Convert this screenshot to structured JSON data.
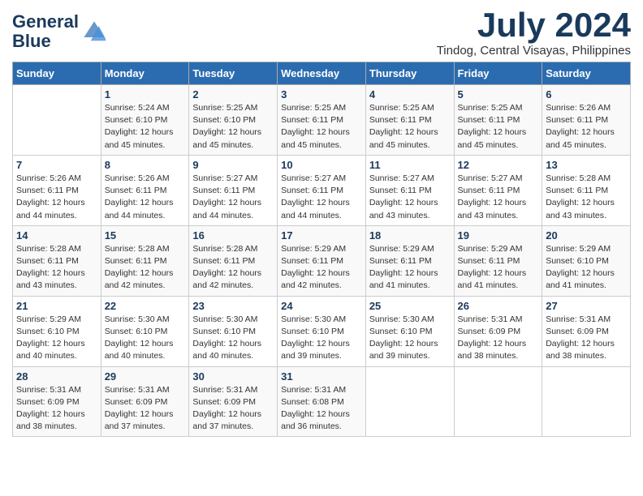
{
  "logo": {
    "line1": "General",
    "line2": "Blue"
  },
  "title": {
    "month_year": "July 2024",
    "location": "Tindog, Central Visayas, Philippines"
  },
  "days_of_week": [
    "Sunday",
    "Monday",
    "Tuesday",
    "Wednesday",
    "Thursday",
    "Friday",
    "Saturday"
  ],
  "weeks": [
    [
      {
        "day": "",
        "info": ""
      },
      {
        "day": "1",
        "info": "Sunrise: 5:24 AM\nSunset: 6:10 PM\nDaylight: 12 hours\nand 45 minutes."
      },
      {
        "day": "2",
        "info": "Sunrise: 5:25 AM\nSunset: 6:10 PM\nDaylight: 12 hours\nand 45 minutes."
      },
      {
        "day": "3",
        "info": "Sunrise: 5:25 AM\nSunset: 6:11 PM\nDaylight: 12 hours\nand 45 minutes."
      },
      {
        "day": "4",
        "info": "Sunrise: 5:25 AM\nSunset: 6:11 PM\nDaylight: 12 hours\nand 45 minutes."
      },
      {
        "day": "5",
        "info": "Sunrise: 5:25 AM\nSunset: 6:11 PM\nDaylight: 12 hours\nand 45 minutes."
      },
      {
        "day": "6",
        "info": "Sunrise: 5:26 AM\nSunset: 6:11 PM\nDaylight: 12 hours\nand 45 minutes."
      }
    ],
    [
      {
        "day": "7",
        "info": "Sunrise: 5:26 AM\nSunset: 6:11 PM\nDaylight: 12 hours\nand 44 minutes."
      },
      {
        "day": "8",
        "info": "Sunrise: 5:26 AM\nSunset: 6:11 PM\nDaylight: 12 hours\nand 44 minutes."
      },
      {
        "day": "9",
        "info": "Sunrise: 5:27 AM\nSunset: 6:11 PM\nDaylight: 12 hours\nand 44 minutes."
      },
      {
        "day": "10",
        "info": "Sunrise: 5:27 AM\nSunset: 6:11 PM\nDaylight: 12 hours\nand 44 minutes."
      },
      {
        "day": "11",
        "info": "Sunrise: 5:27 AM\nSunset: 6:11 PM\nDaylight: 12 hours\nand 43 minutes."
      },
      {
        "day": "12",
        "info": "Sunrise: 5:27 AM\nSunset: 6:11 PM\nDaylight: 12 hours\nand 43 minutes."
      },
      {
        "day": "13",
        "info": "Sunrise: 5:28 AM\nSunset: 6:11 PM\nDaylight: 12 hours\nand 43 minutes."
      }
    ],
    [
      {
        "day": "14",
        "info": "Sunrise: 5:28 AM\nSunset: 6:11 PM\nDaylight: 12 hours\nand 43 minutes."
      },
      {
        "day": "15",
        "info": "Sunrise: 5:28 AM\nSunset: 6:11 PM\nDaylight: 12 hours\nand 42 minutes."
      },
      {
        "day": "16",
        "info": "Sunrise: 5:28 AM\nSunset: 6:11 PM\nDaylight: 12 hours\nand 42 minutes."
      },
      {
        "day": "17",
        "info": "Sunrise: 5:29 AM\nSunset: 6:11 PM\nDaylight: 12 hours\nand 42 minutes."
      },
      {
        "day": "18",
        "info": "Sunrise: 5:29 AM\nSunset: 6:11 PM\nDaylight: 12 hours\nand 41 minutes."
      },
      {
        "day": "19",
        "info": "Sunrise: 5:29 AM\nSunset: 6:11 PM\nDaylight: 12 hours\nand 41 minutes."
      },
      {
        "day": "20",
        "info": "Sunrise: 5:29 AM\nSunset: 6:10 PM\nDaylight: 12 hours\nand 41 minutes."
      }
    ],
    [
      {
        "day": "21",
        "info": "Sunrise: 5:29 AM\nSunset: 6:10 PM\nDaylight: 12 hours\nand 40 minutes."
      },
      {
        "day": "22",
        "info": "Sunrise: 5:30 AM\nSunset: 6:10 PM\nDaylight: 12 hours\nand 40 minutes."
      },
      {
        "day": "23",
        "info": "Sunrise: 5:30 AM\nSunset: 6:10 PM\nDaylight: 12 hours\nand 40 minutes."
      },
      {
        "day": "24",
        "info": "Sunrise: 5:30 AM\nSunset: 6:10 PM\nDaylight: 12 hours\nand 39 minutes."
      },
      {
        "day": "25",
        "info": "Sunrise: 5:30 AM\nSunset: 6:10 PM\nDaylight: 12 hours\nand 39 minutes."
      },
      {
        "day": "26",
        "info": "Sunrise: 5:31 AM\nSunset: 6:09 PM\nDaylight: 12 hours\nand 38 minutes."
      },
      {
        "day": "27",
        "info": "Sunrise: 5:31 AM\nSunset: 6:09 PM\nDaylight: 12 hours\nand 38 minutes."
      }
    ],
    [
      {
        "day": "28",
        "info": "Sunrise: 5:31 AM\nSunset: 6:09 PM\nDaylight: 12 hours\nand 38 minutes."
      },
      {
        "day": "29",
        "info": "Sunrise: 5:31 AM\nSunset: 6:09 PM\nDaylight: 12 hours\nand 37 minutes."
      },
      {
        "day": "30",
        "info": "Sunrise: 5:31 AM\nSunset: 6:09 PM\nDaylight: 12 hours\nand 37 minutes."
      },
      {
        "day": "31",
        "info": "Sunrise: 5:31 AM\nSunset: 6:08 PM\nDaylight: 12 hours\nand 36 minutes."
      },
      {
        "day": "",
        "info": ""
      },
      {
        "day": "",
        "info": ""
      },
      {
        "day": "",
        "info": ""
      }
    ]
  ]
}
